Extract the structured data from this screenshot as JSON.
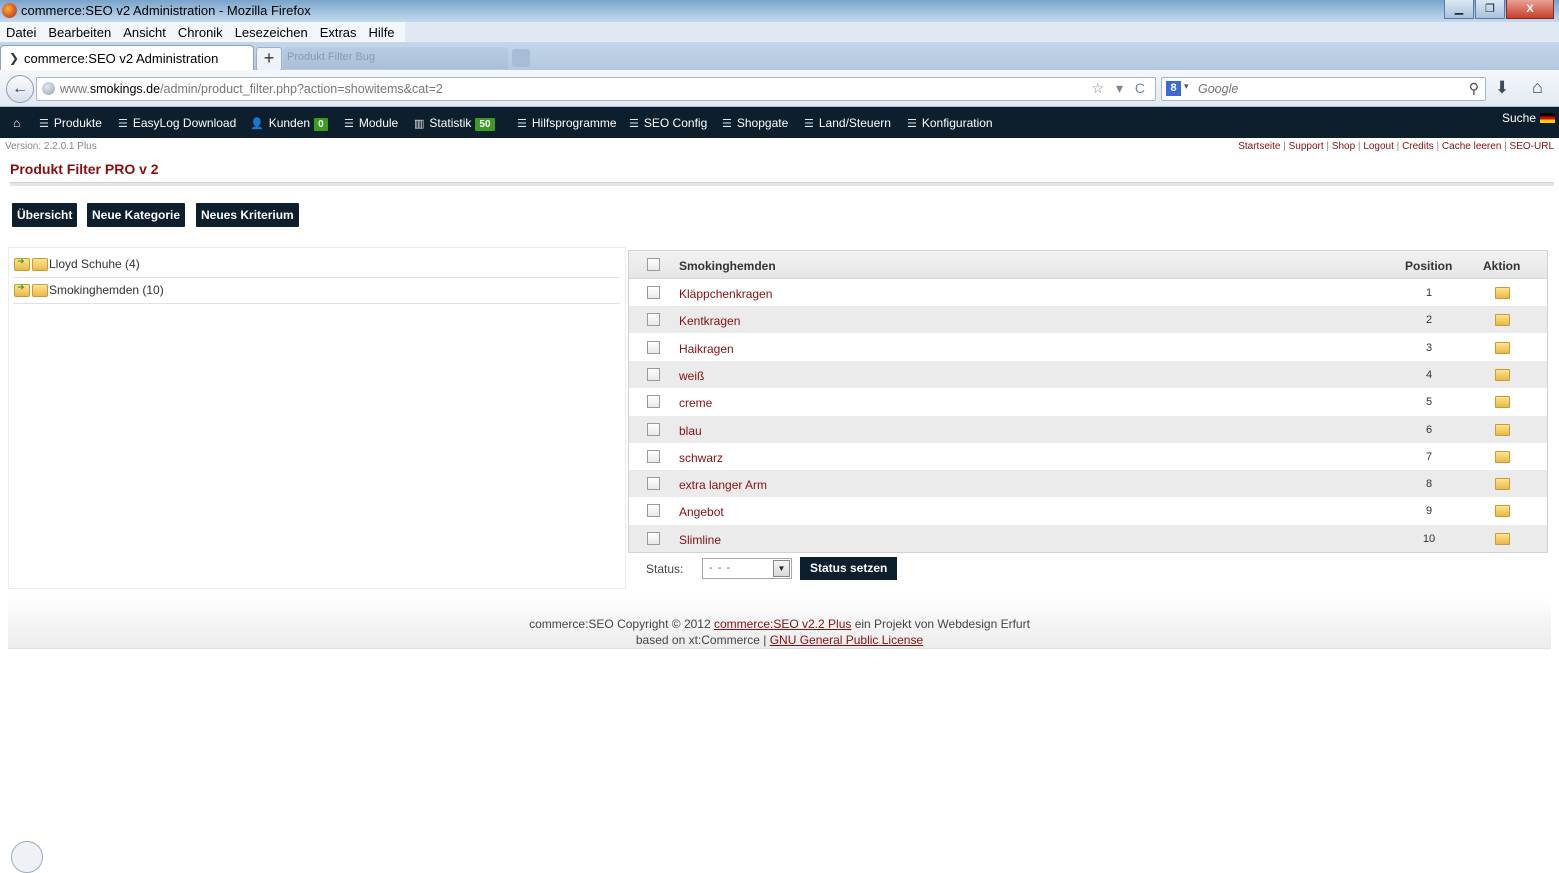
{
  "window": {
    "title": "commerce:SEO v2 Administration - Mozilla Firefox",
    "minimize": "▁",
    "maximize": "❐",
    "close": "X"
  },
  "menubar": [
    "Datei",
    "Bearbeiten",
    "Ansicht",
    "Chronik",
    "Lesezeichen",
    "Extras",
    "Hilfe"
  ],
  "tabs": {
    "active": "commerce:SEO v2 Administration",
    "new_tab": "+",
    "blurred": "Produkt Filter Bug"
  },
  "navbar": {
    "url_prefix": "www.",
    "url_domain": "smokings.de",
    "url_path": "/admin/product_filter.php?action=showitems&cat=2",
    "search_placeholder": "Google",
    "url_tools": "☆ ▾ C"
  },
  "adminnav": {
    "items": [
      "Produkte",
      "EasyLog Download",
      "Kunden",
      "Module",
      "Statistik",
      "Hilfsprogramme",
      "SEO Config",
      "Shopgate",
      "Land/Steuern",
      "Konfiguration"
    ],
    "kunden_badge": "0",
    "statistik_badge": "50",
    "search_label": "Suche"
  },
  "version": "Version: 2.2.0.1 Plus",
  "toplinks": [
    "Startseite",
    "Support",
    "Shop",
    "Logout",
    "Credits",
    "Cache leeren",
    "SEO-URL"
  ],
  "page_title": "Produkt Filter PRO v 2",
  "buttons": {
    "overview": "Übersicht",
    "new_category": "Neue Kategorie",
    "new_criterion": "Neues Kriterium"
  },
  "tree": [
    {
      "label": "Lloyd Schuhe (4)"
    },
    {
      "label": "Smokinghemden (10)"
    }
  ],
  "table": {
    "heading": "Smokinghemden",
    "col_position": "Position",
    "col_action": "Aktion",
    "rows": [
      {
        "name": "Kläppchenkragen",
        "position": "1"
      },
      {
        "name": "Kentkragen",
        "position": "2"
      },
      {
        "name": "Haikragen",
        "position": "3"
      },
      {
        "name": "weiß",
        "position": "4"
      },
      {
        "name": "creme",
        "position": "5"
      },
      {
        "name": "blau",
        "position": "6"
      },
      {
        "name": "schwarz",
        "position": "7"
      },
      {
        "name": "extra langer Arm",
        "position": "8"
      },
      {
        "name": "Angebot",
        "position": "9"
      },
      {
        "name": "Slimline",
        "position": "10"
      }
    ]
  },
  "status": {
    "label": "Status:",
    "selected": "- - -",
    "button": "Status setzen"
  },
  "footer": {
    "line1_a": "commerce:SEO Copyright © 2012 ",
    "line1_link": "commerce:SEO v2.2 Plus",
    "line1_b": " ein Projekt von Webdesign Erfurt",
    "line2_a": "based on xt:Commerce | ",
    "line2_link": "GNU General Public License"
  },
  "colors": {
    "nav_bg": "#0d1e2d",
    "link_red": "#8a0f0f",
    "badge_green": "#3d9b21"
  }
}
